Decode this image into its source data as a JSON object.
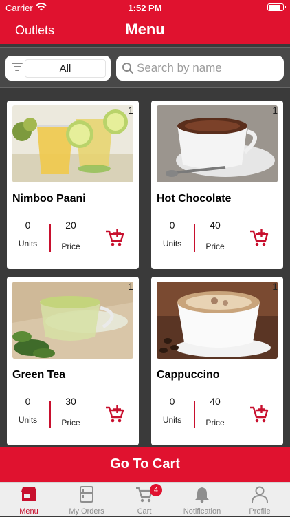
{
  "status_bar": {
    "carrier": "Carrier",
    "time": "1:52 PM",
    "battery_level": 0.9
  },
  "nav": {
    "left_label": "Outlets",
    "title": "Menu"
  },
  "filter": {
    "selected": "All",
    "icon": "filter-icon"
  },
  "search": {
    "placeholder": "Search by name",
    "value": "",
    "icon": "search-icon"
  },
  "menu_items": [
    {
      "index": "1",
      "name": "Nimboo Paani",
      "units": "0",
      "units_label": "Units",
      "price": "20",
      "price_label": "Price",
      "image": "lemonade-photo"
    },
    {
      "index": "1",
      "name": "Hot Chocolate",
      "units": "0",
      "units_label": "Units",
      "price": "40",
      "price_label": "Price",
      "image": "hot-chocolate-photo"
    },
    {
      "index": "1",
      "name": "Green Tea",
      "units": "0",
      "units_label": "Units",
      "price": "30",
      "price_label": "Price",
      "image": "green-tea-photo"
    },
    {
      "index": "1",
      "name": "Cappuccino",
      "units": "0",
      "units_label": "Units",
      "price": "40",
      "price_label": "Price",
      "image": "cappuccino-photo"
    }
  ],
  "cart_button": {
    "label": "Go To Cart"
  },
  "tab_bar": {
    "tabs": [
      {
        "label": "Menu",
        "icon": "store-icon",
        "active": true
      },
      {
        "label": "My Orders",
        "icon": "orders-icon",
        "active": false
      },
      {
        "label": "Cart",
        "icon": "cart-icon",
        "active": false,
        "badge": "4"
      },
      {
        "label": "Notification",
        "icon": "bell-icon",
        "active": false
      },
      {
        "label": "Profile",
        "icon": "person-icon",
        "active": false
      }
    ]
  },
  "colors": {
    "brand": "#e0122f",
    "accent": "#c8102e",
    "background": "#3a3a3a",
    "tab_inactive": "#8e8e8e"
  }
}
